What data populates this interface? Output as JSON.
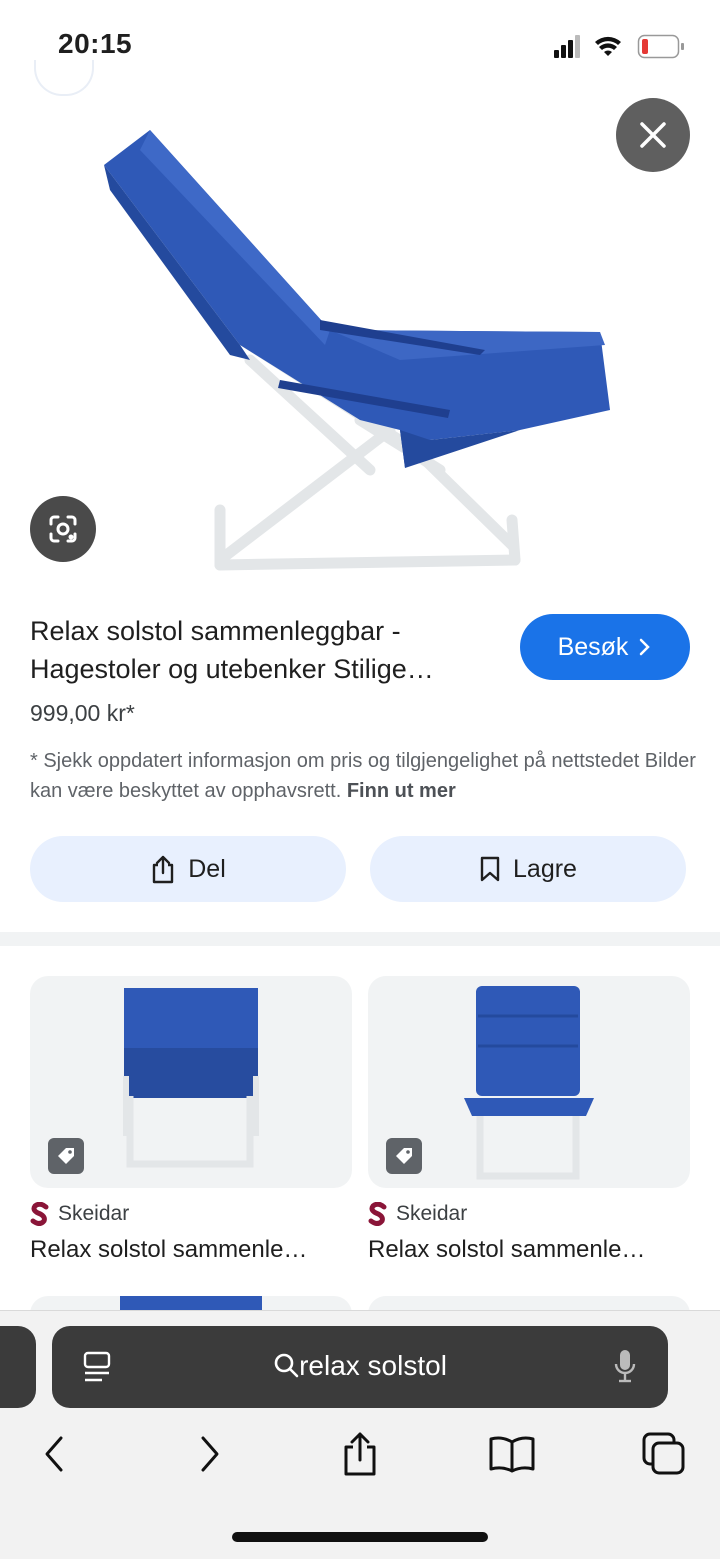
{
  "status_bar": {
    "time": "20:15"
  },
  "product": {
    "title": "Relax solstol sammenleggbar - Hagestoler og utebenker Stilige…",
    "price": "999,00 kr*",
    "disclaimer": "* Sjekk oppdatert informasjon om pris og tilgjengelighet på nettstedet Bilder kan være beskyttet av opphavsrett.",
    "learn_more": "Finn ut mer",
    "visit_label": "Besøk",
    "accent_color": "#1a73e8"
  },
  "actions": {
    "share_label": "Del",
    "save_label": "Lagre"
  },
  "related": [
    {
      "source": "Skeidar",
      "title": "Relax solstol sammenle…"
    },
    {
      "source": "Skeidar",
      "title": "Relax solstol sammenle…"
    }
  ],
  "browser": {
    "search_query": "relax solstol"
  }
}
